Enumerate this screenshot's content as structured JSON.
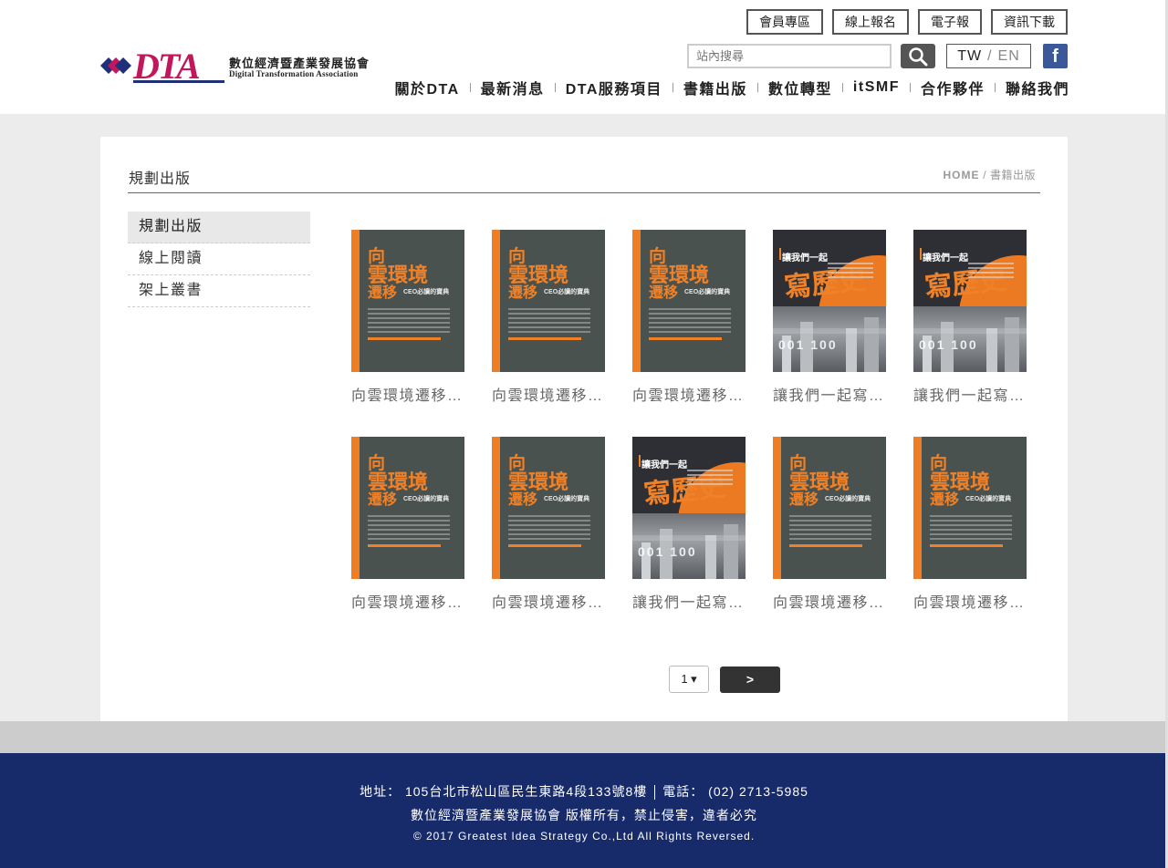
{
  "brand": {
    "logo_text": "DTA",
    "name_cn": "數位經濟暨產業發展協會",
    "name_en": "Digital Transformation Association"
  },
  "top_buttons": [
    "會員專區",
    "線上報名",
    "電子報",
    "資訊下載"
  ],
  "search": {
    "placeholder": "站內搜尋"
  },
  "language": {
    "current": "TW",
    "separator": "/",
    "other": "EN"
  },
  "nav": [
    "關於DTA",
    "最新消息",
    "DTA服務項目",
    "書籍出版",
    "數位轉型",
    "itSMF",
    "合作夥伴",
    "聯絡我們"
  ],
  "page": {
    "title": "規劃出版",
    "breadcrumb": {
      "home": "HOME",
      "sep": "/",
      "current": "書籍出版"
    }
  },
  "sidebar": [
    {
      "label": "規劃出版",
      "active": true
    },
    {
      "label": "線上閱讀",
      "active": false
    },
    {
      "label": "架上叢書",
      "active": false
    }
  ],
  "books": [
    {
      "title": "向雲環境遷移…",
      "cover": "a"
    },
    {
      "title": "向雲環境遷移…",
      "cover": "a"
    },
    {
      "title": "向雲環境遷移…",
      "cover": "a"
    },
    {
      "title": "讓我們一起寫…",
      "cover": "b"
    },
    {
      "title": "讓我們一起寫…",
      "cover": "b"
    },
    {
      "title": "向雲環境遷移…",
      "cover": "a"
    },
    {
      "title": "向雲環境遷移…",
      "cover": "a"
    },
    {
      "title": "讓我們一起寫…",
      "cover": "b"
    },
    {
      "title": "向雲環境遷移…",
      "cover": "a"
    },
    {
      "title": "向雲環境遷移…",
      "cover": "a"
    }
  ],
  "cover_text": {
    "a": {
      "l1": "向",
      "l2": "雲環境",
      "l3": "遷移",
      "l4": "CEO必讀的寶典"
    },
    "b": {
      "head": "讓我們一起",
      "callig": "寫歷史",
      "digits": "001 100"
    }
  },
  "pagination": {
    "page": "1 ▾",
    "next": ">"
  },
  "footer": {
    "address": "地址： 105台北市松山區民生東路4段133號8樓",
    "phone": "電話： (02) 2713-5985",
    "rights_cn": "數位經濟暨產業發展協會 版權所有，禁止侵害，違者必究",
    "copyright": "© 2017 Greatest Idea Strategy Co.,Ltd All Rights Reversed."
  },
  "colors": {
    "footer_bg": "#172a6a",
    "logo_magenta": "#c2185b",
    "logo_navy": "#1f2f7a",
    "cover_orange": "#ef8128"
  }
}
